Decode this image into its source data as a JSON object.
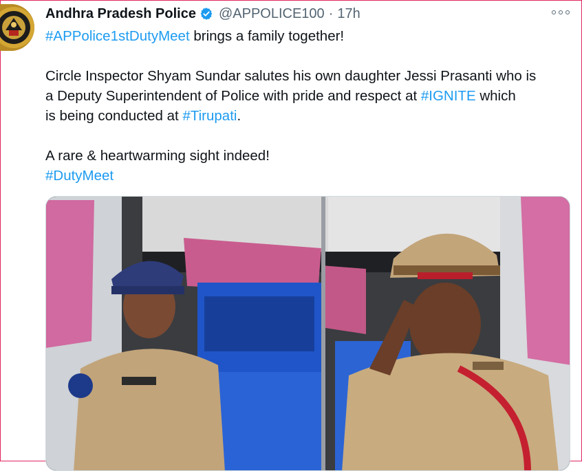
{
  "tweet": {
    "author_name": "Andhra Pradesh Police",
    "handle": "@APPOLICE100",
    "separator": "·",
    "time": "17h",
    "line1_tag": "#APPolice1stDutyMeet",
    "line1_rest": " brings a family together!",
    "line2": "Circle Inspector Shyam Sundar salutes his own daughter Jessi Prasanti who is",
    "line3_pre": "a Deputy Superintendent of Police with pride and respect at ",
    "line3_tag": "#IGNITE",
    "line3_post": " which",
    "line4_pre": "is being conducted at ",
    "line4_tag": "#Tirupati",
    "line4_post": ".",
    "line5": "A rare & heartwarming sight indeed!",
    "line6_tag": "#DutyMeet"
  },
  "icons": {
    "verified": "verified-badge-icon",
    "more": "more-options-icon"
  },
  "colors": {
    "link": "#1d9bf0",
    "text": "#0f1419",
    "muted": "#536471",
    "frame": "#e0245e"
  }
}
